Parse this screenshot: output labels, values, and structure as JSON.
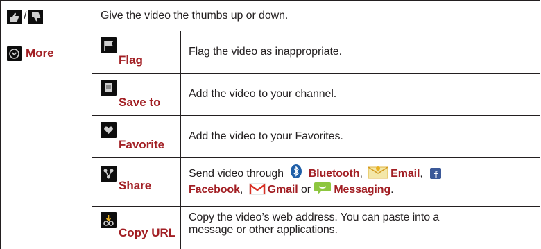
{
  "row1": {
    "separator": "/",
    "description": "Give the video the thumbs up or down."
  },
  "more": {
    "label": "More"
  },
  "rows": [
    {
      "label": "Flag",
      "icon": "flag-icon",
      "description": "Flag the video as inappropriate."
    },
    {
      "label": "Save to",
      "icon": "save-to-icon",
      "description": "Add the video to your channel."
    },
    {
      "label": "Favorite",
      "icon": "heart-icon",
      "description": "Add the video to your Favorites."
    },
    {
      "label": "Share",
      "icon": "share-icon",
      "description_prefix": "Send video through",
      "bluetooth": "Bluetooth",
      "comma1": ",",
      "email": "Email",
      "comma2": ",",
      "facebook": "Facebook",
      "comma3": ",",
      "gmail": "Gmail",
      "or": "or",
      "messaging": "Messaging",
      "period": "."
    },
    {
      "label": "Copy URL",
      "icon": "link-icon",
      "description_line1": "Copy the video’s web address. You can paste into a",
      "description_line2": "message or other applications."
    }
  ],
  "colors": {
    "label_red": "#a21f24",
    "border": "#231f20",
    "text": "#231f20"
  }
}
